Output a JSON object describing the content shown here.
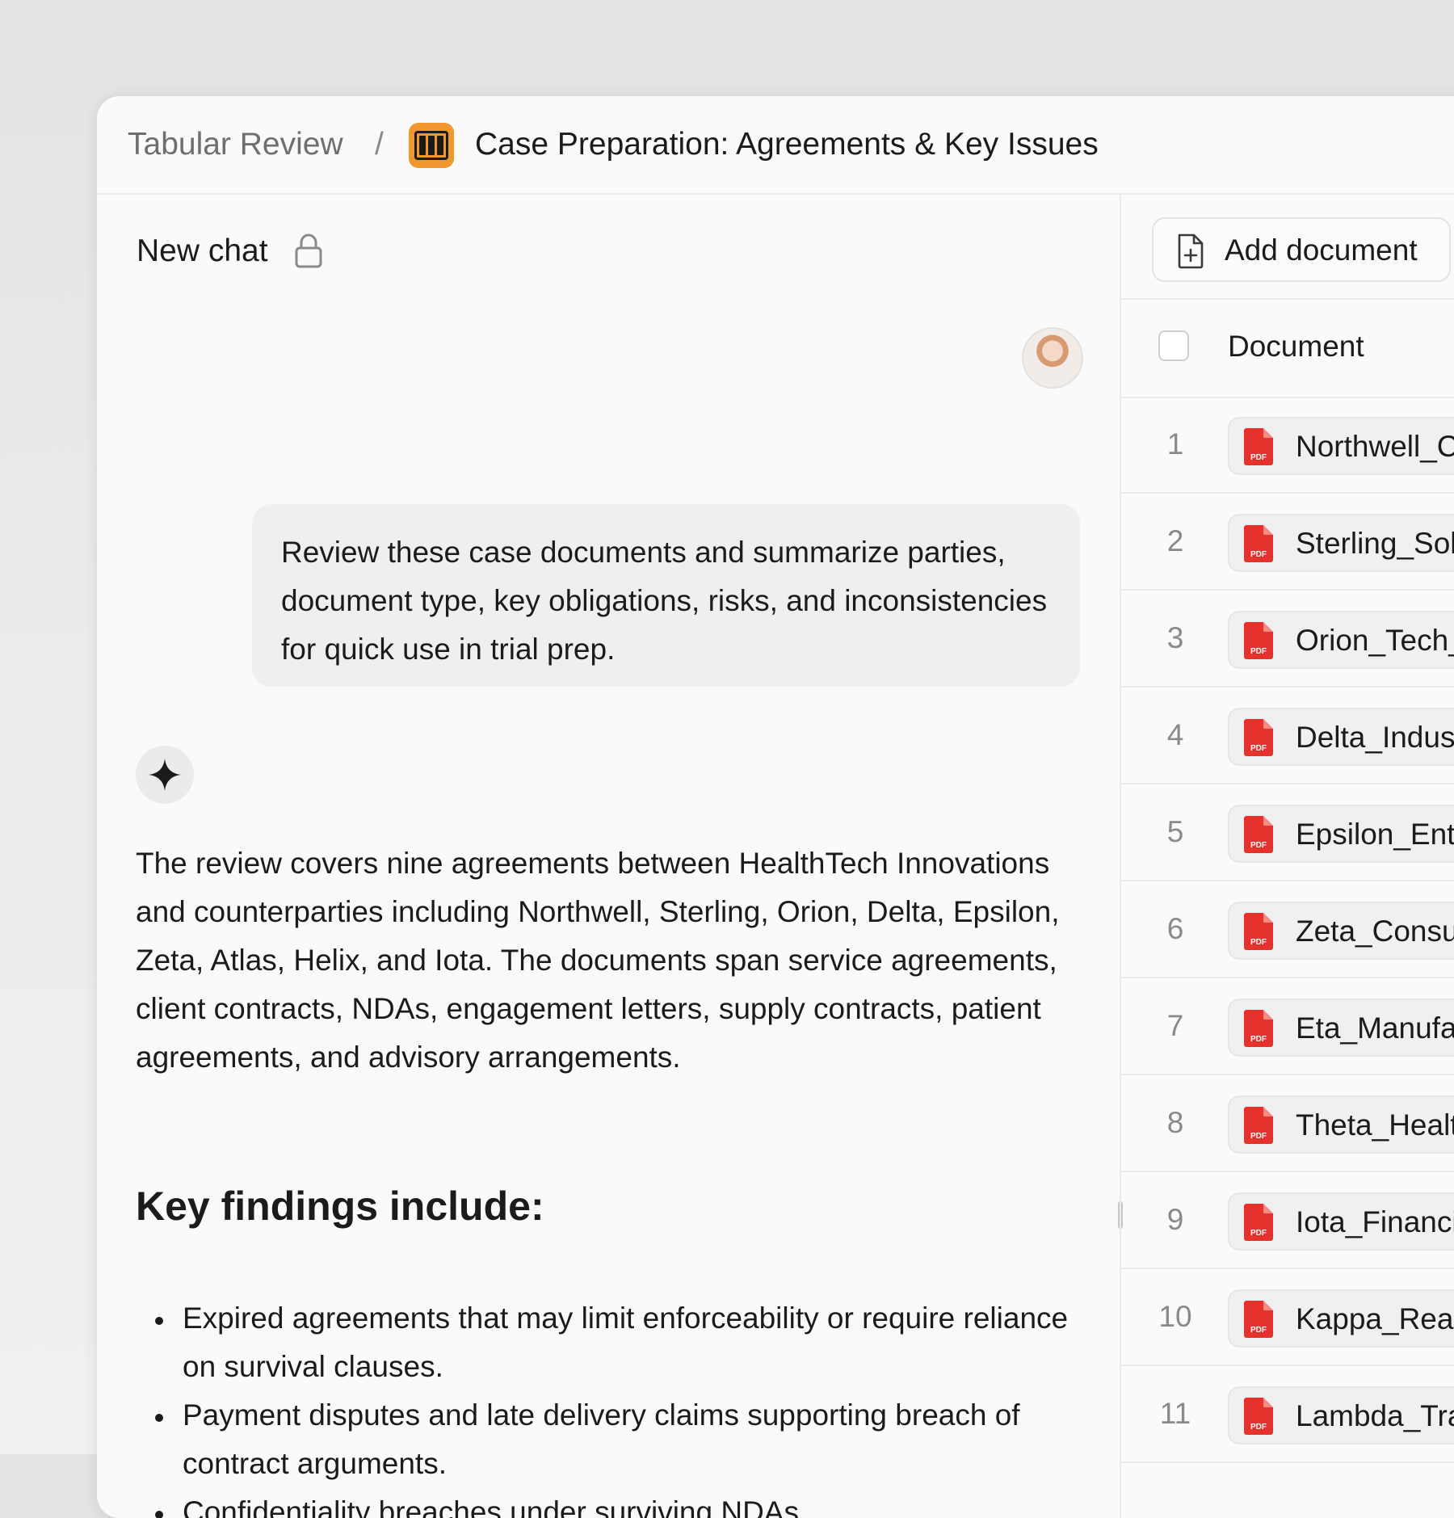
{
  "breadcrumb": {
    "root": "Tabular Review",
    "separator": "/",
    "title": "Case Preparation: Agreements & Key Issues",
    "app_icon": "columns-icon",
    "app_icon_color": "#f0982f"
  },
  "chat": {
    "title": "New chat",
    "lock_icon": "lock-icon",
    "user_message": "Review these case documents and summarize parties, document type, key obligations, risks, and inconsistencies for quick use in trial prep.",
    "assistant_paragraph": "The review covers nine agreements between HealthTech Innovations and counterparties including Northwell, Sterling, Orion, Delta, Epsilon, Zeta, Atlas, Helix, and Iota. The documents span service agreements, client contracts, NDAs, engagement letters, supply contracts, patient agreements, and advisory arrangements.",
    "findings_heading": "Key findings include:",
    "findings": [
      "Expired agreements that may limit enforceability or require reliance on survival clauses.",
      "Payment disputes and late delivery claims supporting breach of contract arguments.",
      "Confidentiality breaches under surviving NDAs."
    ]
  },
  "documents": {
    "add_label": "Add document",
    "column_header": "Document",
    "pdf_badge": "PDF",
    "pdf_color": "#e5322d",
    "rows": [
      {
        "num": "1",
        "name": "Northwell_C"
      },
      {
        "num": "2",
        "name": "Sterling_Sol"
      },
      {
        "num": "3",
        "name": "Orion_Tech_"
      },
      {
        "num": "4",
        "name": "Delta_Indus"
      },
      {
        "num": "5",
        "name": "Epsilon_Ente"
      },
      {
        "num": "6",
        "name": "Zeta_Consu"
      },
      {
        "num": "7",
        "name": "Eta_Manufa"
      },
      {
        "num": "8",
        "name": "Theta_Healt"
      },
      {
        "num": "9",
        "name": "Iota_Financi"
      },
      {
        "num": "10",
        "name": "Kappa_Real"
      },
      {
        "num": "11",
        "name": "Lambda_Tra"
      }
    ]
  }
}
